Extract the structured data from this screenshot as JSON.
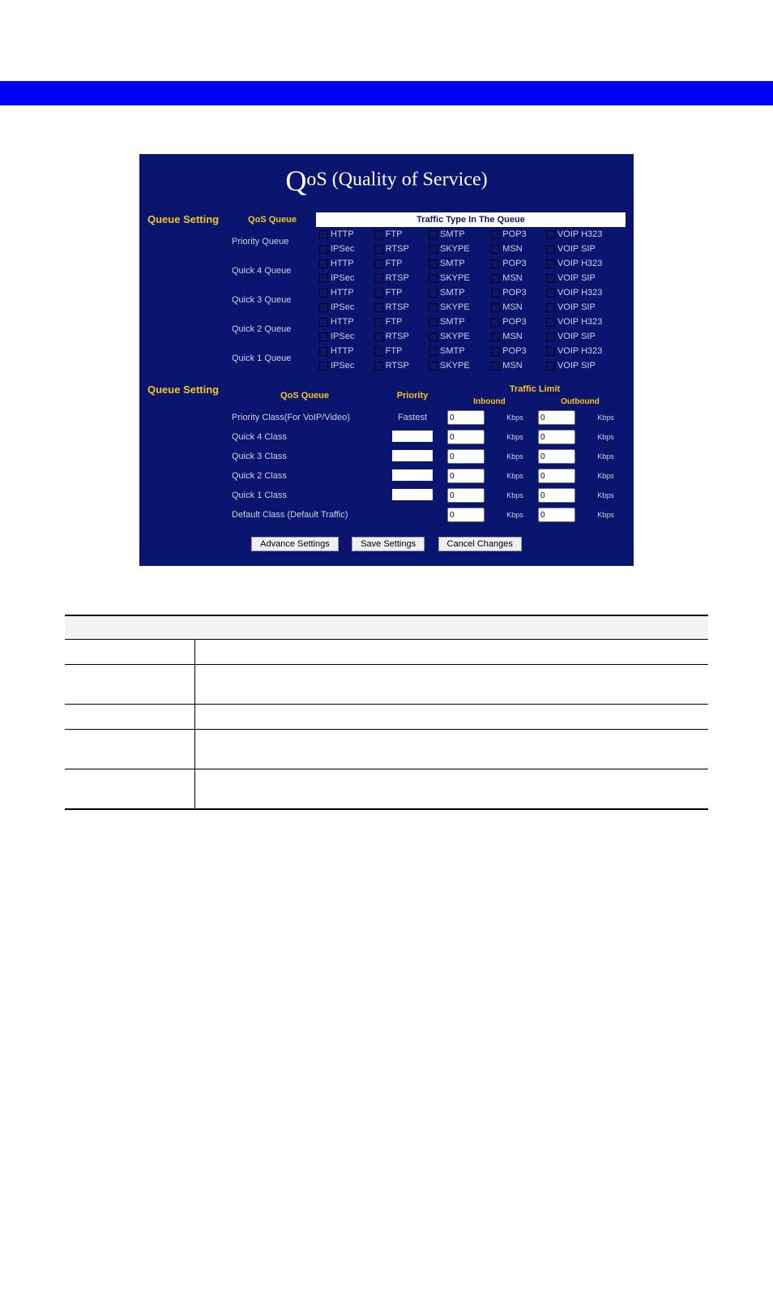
{
  "title_part1": "Q",
  "title_part2": "oS (Quality of Service)",
  "section1_label": "Queue Setting",
  "section2_label": "Queue Setting",
  "table1": {
    "hdr_queue": "QoS Queue",
    "hdr_traffic": "Traffic Type In The Queue",
    "rows": [
      {
        "name": "Priority Queue"
      },
      {
        "name": "Quick 4 Queue"
      },
      {
        "name": "Quick 3 Queue"
      },
      {
        "name": "Quick 2 Queue"
      },
      {
        "name": "Quick 1 Queue"
      }
    ],
    "types_row1": [
      "HTTP",
      "FTP",
      "SMTP",
      "POP3",
      "VOIP H323"
    ],
    "types_row2": [
      "IPSec",
      "RTSP",
      "SKYPE",
      "MSN",
      "VOIP SIP"
    ]
  },
  "table2": {
    "hdr_queue": "QoS Queue",
    "hdr_priority": "Priority",
    "hdr_traffic": "Traffic Limit",
    "hdr_inbound": "Inbound",
    "hdr_outbound": "Outbound",
    "rows": [
      {
        "name": "Priority Class(For VoIP/Video)",
        "priority_text": "Fastest",
        "in": "0",
        "out": "0"
      },
      {
        "name": "Quick 4 Class",
        "priority_text": "",
        "in": "0",
        "out": "0"
      },
      {
        "name": "Quick 3 Class",
        "priority_text": "",
        "in": "0",
        "out": "0"
      },
      {
        "name": "Quick 2 Class",
        "priority_text": "",
        "in": "0",
        "out": "0"
      },
      {
        "name": "Quick 1 Class",
        "priority_text": "",
        "in": "0",
        "out": "0"
      },
      {
        "name": "Default Class (Default Traffic)",
        "priority_text": "",
        "in": "0",
        "out": "0",
        "no_priority": true
      }
    ],
    "unit": "Kbps"
  },
  "buttons": {
    "advance": "Advance Settings",
    "save": "Save Settings",
    "cancel": "Cancel Changes"
  }
}
